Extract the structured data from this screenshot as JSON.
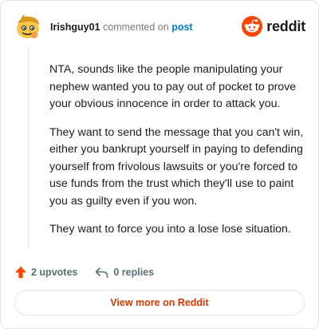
{
  "header": {
    "username": "Irishguy01",
    "commented_text": "commented on",
    "post_link": "post",
    "brand": "reddit"
  },
  "comment": {
    "paragraphs": [
      "NTA, sounds like the people manipulating your nephew wanted you to pay out of pocket to prove your obvious innocence in order to attack you.",
      "They want to send the message that you can't win, either you bankrupt yourself in paying to defending yourself from frivolous lawsuits or you're forced to use funds from the trust which they'll use to paint you as guilty even if you won.",
      "They want to force you into a lose lose situation."
    ]
  },
  "actions": {
    "upvotes": "2 upvotes",
    "replies": "0 replies"
  },
  "footer": {
    "view_more": "View more on Reddit"
  },
  "colors": {
    "accent": "#ff4500",
    "link": "#0079d3",
    "view_more_text": "#d93a00"
  }
}
